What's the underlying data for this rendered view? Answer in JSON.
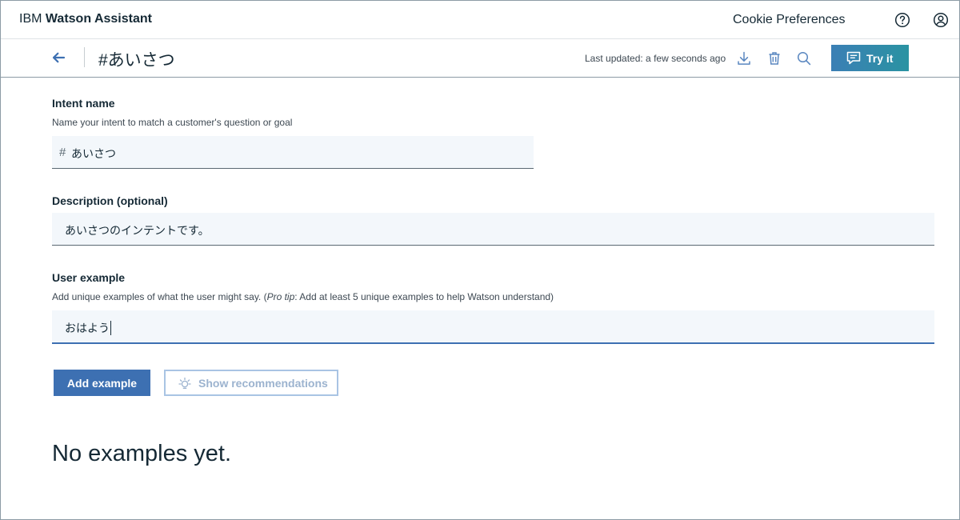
{
  "header": {
    "brand_light": "IBM",
    "brand_bold": "Watson Assistant",
    "cookie_link": "Cookie Preferences",
    "help_icon": "help-circle-icon",
    "user_icon": "user-avatar-icon"
  },
  "toolbar": {
    "back_icon": "arrow-left-icon",
    "intent_title": "#あいさつ",
    "last_updated": "Last updated: a few seconds ago",
    "download_icon": "download-icon",
    "delete_icon": "trash-icon",
    "search_icon": "search-icon",
    "try_it_label": "Try it",
    "try_it_icon": "chat-icon"
  },
  "form": {
    "intent_name": {
      "label": "Intent name",
      "help": "Name your intent to match a customer's question or goal",
      "prefix": "#",
      "value": "あいさつ"
    },
    "description": {
      "label": "Description (optional)",
      "value": "あいさつのインテントです。"
    },
    "user_example": {
      "label": "User example",
      "help_before": "Add unique examples of what the user might say. (",
      "help_tip": "Pro tip",
      "help_after": ": Add at least 5 unique examples to help Watson understand)",
      "value": "おはよう"
    },
    "add_example_label": "Add example",
    "show_recommendations_label": "Show recommendations",
    "show_recommendations_icon": "lightbulb-icon"
  },
  "examples": {
    "empty_message": "No examples yet."
  },
  "colors": {
    "primary": "#3d70b2",
    "try_it_gradient_start": "#3b7fb5",
    "try_it_gradient_end": "#2a93a2",
    "field_background": "#f3f7fb",
    "disabled_button_border": "#a9c4e4"
  }
}
